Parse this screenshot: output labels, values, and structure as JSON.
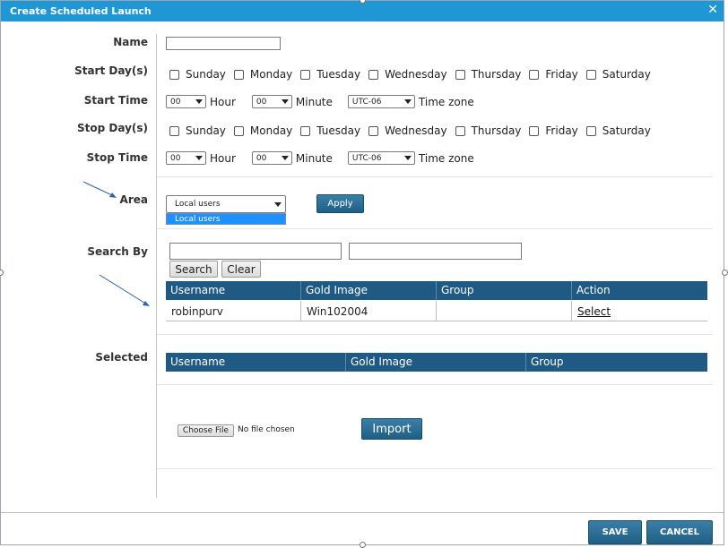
{
  "dialog": {
    "title": "Create Scheduled Launch",
    "close_glyph": "✕"
  },
  "labels": {
    "name": "Name",
    "start_days": "Start Day(s)",
    "start_time": "Start Time",
    "stop_days": "Stop Day(s)",
    "stop_time": "Stop Time",
    "area": "Area",
    "search_by": "Search By",
    "selected": "Selected"
  },
  "name_input": {
    "value": ""
  },
  "days": [
    "Sunday",
    "Monday",
    "Tuesday",
    "Wednesday",
    "Thursday",
    "Friday",
    "Saturday"
  ],
  "start_time": {
    "hour": "00",
    "hour_unit": "Hour",
    "minute": "00",
    "minute_unit": "Minute",
    "timezone": "UTC-06",
    "timezone_unit": "Time zone"
  },
  "stop_time": {
    "hour": "00",
    "hour_unit": "Hour",
    "minute": "00",
    "minute_unit": "Minute",
    "timezone": "UTC-06",
    "timezone_unit": "Time zone"
  },
  "area": {
    "selected": "Local users",
    "options": [
      "Local users"
    ],
    "apply_label": "Apply"
  },
  "search": {
    "field1": "",
    "field2": "",
    "search_label": "Search",
    "clear_label": "Clear"
  },
  "results_table": {
    "columns": [
      "Username",
      "Gold Image",
      "Group",
      "Action"
    ],
    "rows": [
      {
        "username": "robinpurv",
        "gold_image": "Win102004",
        "group": "",
        "action": "Select"
      }
    ]
  },
  "selected_table": {
    "columns": [
      "Username",
      "Gold Image",
      "Group"
    ]
  },
  "file": {
    "choose_label": "Choose File",
    "status": "No file chosen",
    "import_label": "Import"
  },
  "footer": {
    "save_label": "SAVE",
    "cancel_label": "CANCEL"
  },
  "colors": {
    "titlebar": "#1f97d4",
    "table_header": "#1e5a84",
    "button": "#1f5f86",
    "dropdown_highlight": "#1e90ff",
    "annotation_arrow": "#2f64a8"
  }
}
